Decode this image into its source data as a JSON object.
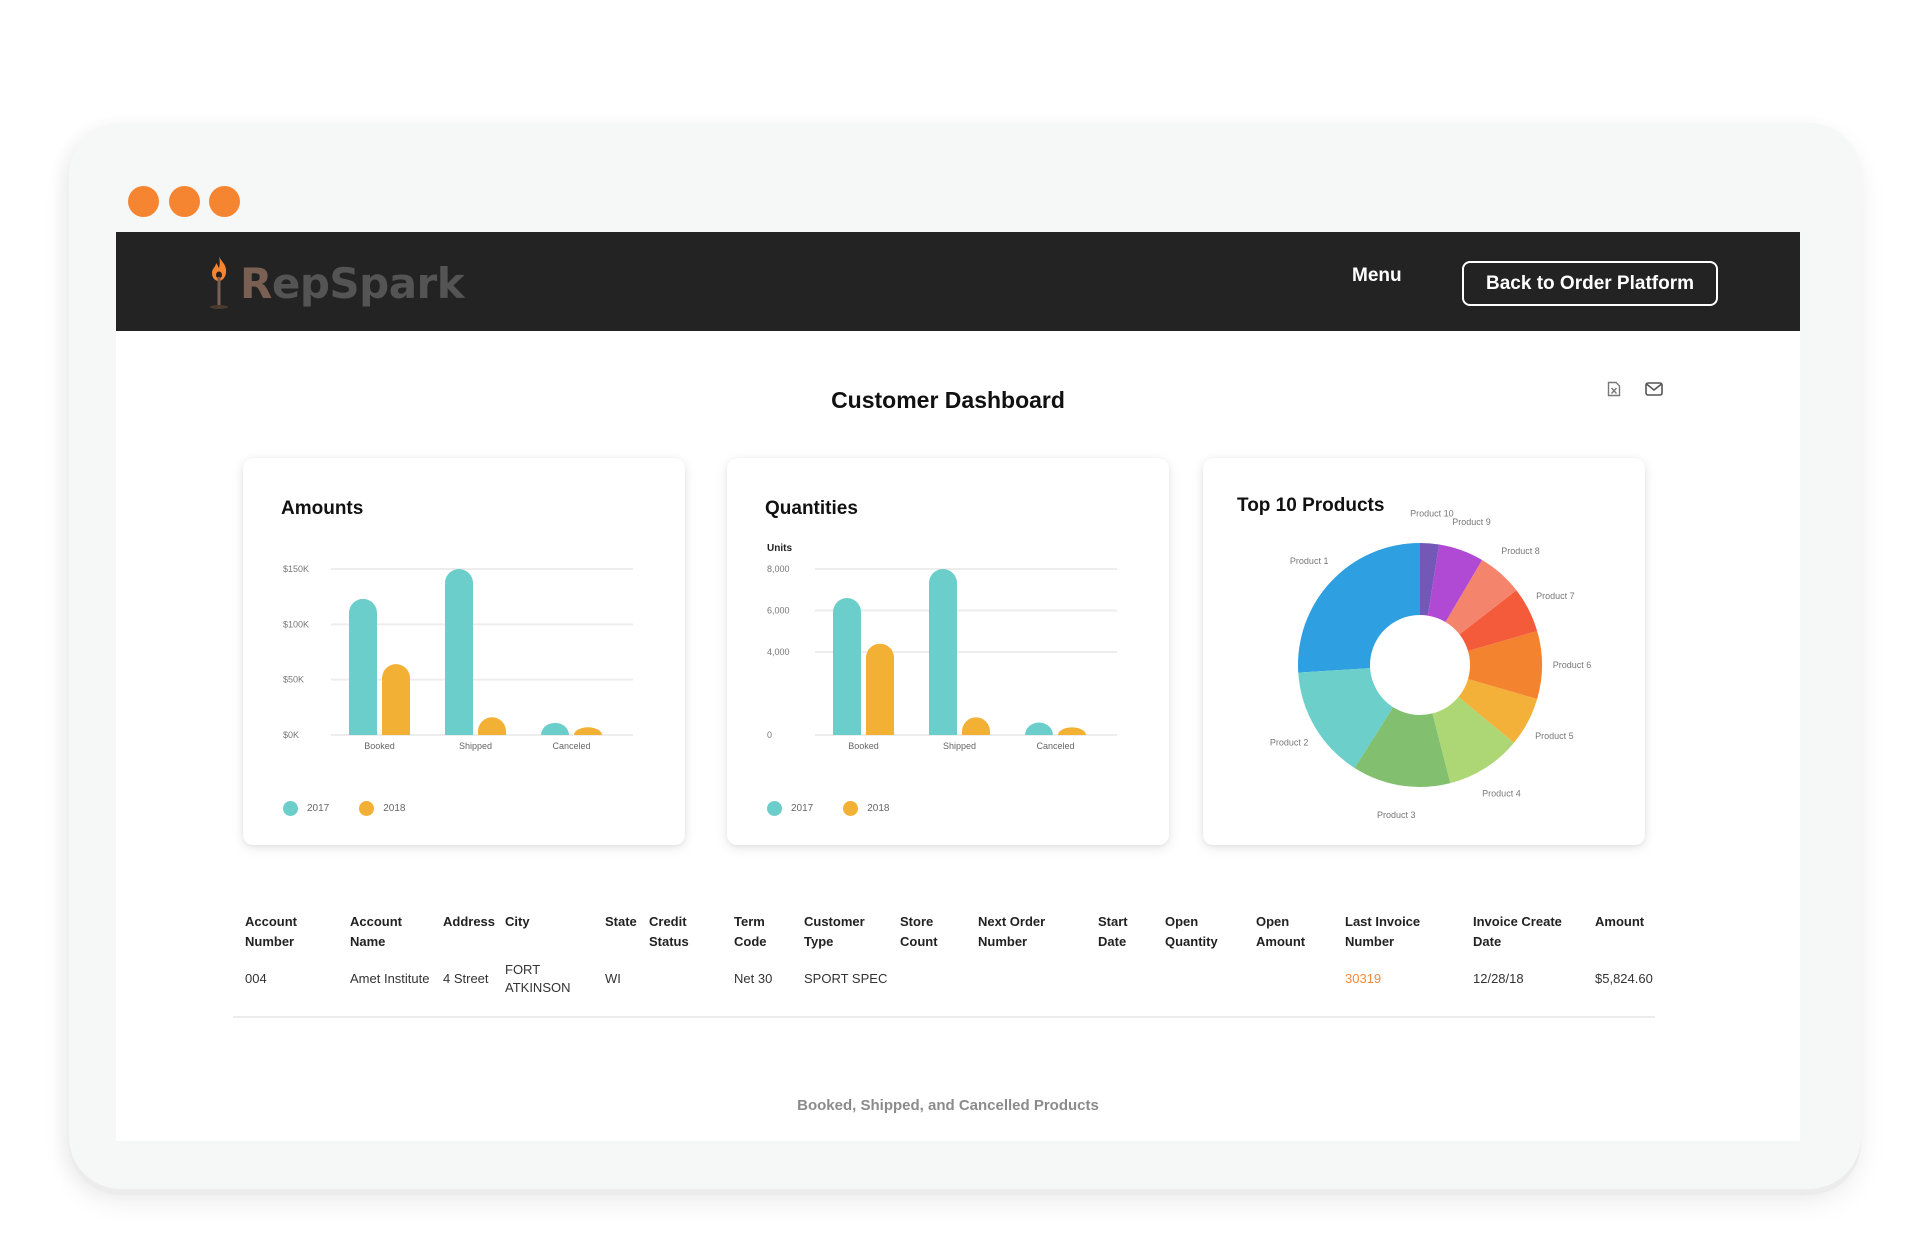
{
  "window": {
    "dots": [
      "window-dot-1",
      "window-dot-2",
      "window-dot-3"
    ],
    "dot_color": "#f68532"
  },
  "header": {
    "logo_initial": "R",
    "logo_rest": "epSpark",
    "menu_label": "Menu",
    "back_button_label": "Back to Order Platform"
  },
  "page": {
    "title": "Customer Dashboard",
    "export_icon": "excel-export-icon",
    "email_icon": "email-icon"
  },
  "colors": {
    "series_2017": "#6cceca",
    "series_2018": "#f2b035",
    "accent": "#f08a3c"
  },
  "chart_data": [
    {
      "type": "bar",
      "title": "Amounts",
      "xlabel": "",
      "ylabel": "",
      "categories": [
        "Booked",
        "Shipped",
        "Canceled"
      ],
      "series": [
        {
          "name": "2017",
          "values": [
            123000,
            150000,
            11000
          ]
        },
        {
          "name": "2018",
          "values": [
            64000,
            16000,
            7000
          ]
        }
      ],
      "yticks": [
        0,
        50000,
        100000,
        150000
      ],
      "ytick_labels": [
        "$0K",
        "$50K",
        "$100K",
        "$150K"
      ],
      "ylim": [
        0,
        150000
      ],
      "grid": true,
      "legend": "bottom-left"
    },
    {
      "type": "bar",
      "title": "Quantities",
      "xlabel": "",
      "ylabel": "Units",
      "categories": [
        "Booked",
        "Shipped",
        "Canceled"
      ],
      "series": [
        {
          "name": "2017",
          "values": [
            6600,
            8000,
            600
          ]
        },
        {
          "name": "2018",
          "values": [
            4400,
            850,
            370
          ]
        }
      ],
      "yticks": [
        0,
        4000,
        6000,
        8000
      ],
      "ytick_labels": [
        "0",
        "4,000",
        "6,000",
        "8,000"
      ],
      "ylim": [
        0,
        8000
      ],
      "grid": true,
      "legend": "bottom-left"
    },
    {
      "type": "pie",
      "title": "Top 10 Products",
      "donut": true,
      "direction": "counter-clockwise from top",
      "labels": [
        "Product 1",
        "Product 2",
        "Product 3",
        "Product 4",
        "Product 5",
        "Product 6",
        "Product 7",
        "Product 8",
        "Product 9",
        "Product 10"
      ],
      "values": [
        26,
        15,
        13,
        10,
        6.5,
        9,
        6,
        6,
        6,
        2.5
      ],
      "colors": [
        "#2e9fe0",
        "#6ccfca",
        "#82bf6e",
        "#add674",
        "#f3b13a",
        "#f4832f",
        "#f45b3a",
        "#f5846c",
        "#b04ad5",
        "#7358b8"
      ]
    }
  ],
  "table": {
    "columns": [
      [
        "Account",
        "Number"
      ],
      [
        "Account",
        "Name"
      ],
      [
        "Address",
        ""
      ],
      [
        "City",
        ""
      ],
      [
        "State",
        ""
      ],
      [
        "Credit",
        "Status"
      ],
      [
        "Term",
        "Code"
      ],
      [
        "Customer",
        "Type"
      ],
      [
        "Store",
        "Count"
      ],
      [
        "Next Order",
        "Number"
      ],
      [
        "Start",
        "Date"
      ],
      [
        "Open",
        "Quantity"
      ],
      [
        "Open",
        "Amount"
      ],
      [
        "Last Invoice",
        "Number"
      ],
      [
        "Invoice Create",
        "Date"
      ],
      [
        "Amount",
        ""
      ]
    ],
    "rows": [
      [
        "004",
        "Amet Institute",
        "4 Street",
        "FORT\nATKINSON",
        "WI",
        "",
        "Net 30",
        "SPORT SPEC",
        "",
        "",
        "",
        "",
        "",
        "30319",
        "12/28/18",
        "$5,824.60"
      ]
    ]
  },
  "footer": {
    "section_label": "Booked, Shipped, and Cancelled Products"
  }
}
